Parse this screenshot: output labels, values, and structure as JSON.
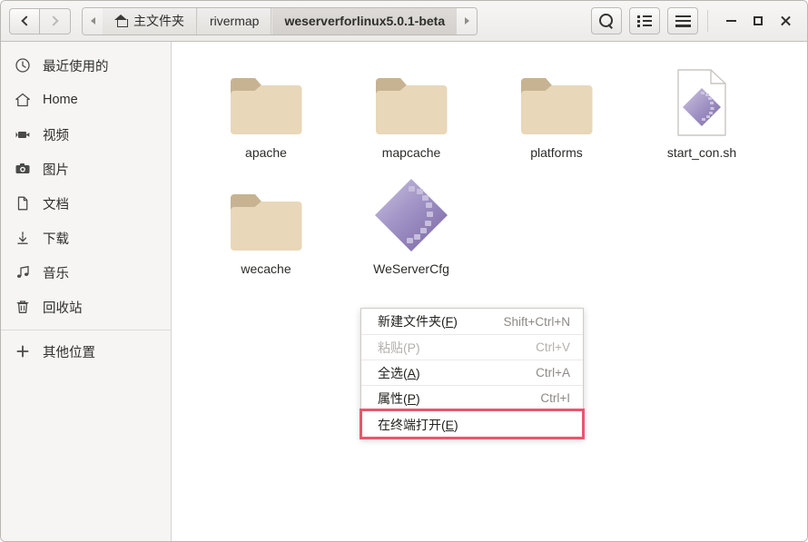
{
  "header": {
    "nav": {
      "back_label": "Back",
      "forward_label": "Forward"
    },
    "pathbar": {
      "scroll_left": "◂",
      "scroll_right": "▸",
      "crumbs": [
        {
          "label": "主文件夹",
          "icon": "home-icon",
          "active": false
        },
        {
          "label": "rivermap",
          "icon": "",
          "active": false
        },
        {
          "label": "weserverforlinux5.0.1-beta",
          "icon": "",
          "active": true
        }
      ]
    },
    "tools": [
      {
        "name": "search-button",
        "icon": "search-icon",
        "label": "Search"
      },
      {
        "name": "view-list-button",
        "icon": "list-view-icon",
        "label": "View options"
      },
      {
        "name": "main-menu-button",
        "icon": "hamburger-menu-icon",
        "label": "Menu"
      }
    ],
    "window_controls": [
      {
        "name": "minimize-button",
        "icon": "minimize-icon",
        "label": "Minimize"
      },
      {
        "name": "maximize-button",
        "icon": "maximize-icon",
        "label": "Maximize"
      },
      {
        "name": "close-button",
        "icon": "close-icon",
        "label": "Close"
      }
    ]
  },
  "sidebar": {
    "items": [
      {
        "label": "最近使用的",
        "icon": "clock-icon"
      },
      {
        "label": "Home",
        "icon": "home-icon"
      },
      {
        "label": "视频",
        "icon": "video-camera-icon"
      },
      {
        "label": "图片",
        "icon": "camera-icon"
      },
      {
        "label": "文档",
        "icon": "document-icon"
      },
      {
        "label": "下载",
        "icon": "download-arrow-icon"
      },
      {
        "label": "音乐",
        "icon": "music-note-icon"
      },
      {
        "label": "回收站",
        "icon": "trash-icon"
      }
    ],
    "other_locations": {
      "label": "其他位置",
      "icon": "plus-icon"
    }
  },
  "content": {
    "files": [
      {
        "name": "apache",
        "type": "folder"
      },
      {
        "name": "mapcache",
        "type": "folder"
      },
      {
        "name": "platforms",
        "type": "folder"
      },
      {
        "name": "start_con.sh",
        "type": "script"
      },
      {
        "name": "wecache",
        "type": "folder"
      },
      {
        "name": "WeServerCfg",
        "type": "executable"
      }
    ]
  },
  "context_menu": {
    "items": [
      {
        "label": "新建文件夹(",
        "mnemonic": "F",
        "label_end": ")",
        "accel": "Shift+Ctrl+N",
        "disabled": false,
        "highlighted": false
      },
      {
        "label": "粘贴(P",
        "mnemonic": "",
        "label_end": ")",
        "accel": "Ctrl+V",
        "disabled": true,
        "highlighted": false
      },
      {
        "label": "全选(",
        "mnemonic": "A",
        "label_end": ")",
        "accel": "Ctrl+A",
        "disabled": false,
        "highlighted": false
      },
      {
        "label": "属性(",
        "mnemonic": "P",
        "label_end": ")",
        "accel": "Ctrl+I",
        "disabled": false,
        "highlighted": false
      },
      {
        "label": "在终端打开(",
        "mnemonic": "E",
        "label_end": ")",
        "accel": "",
        "disabled": false,
        "highlighted": true
      }
    ],
    "highlight_color": "#e8566d"
  },
  "colors": {
    "folder_body": "#e8d7b8",
    "folder_tab": "#c7b392",
    "icon_purple_light": "#b3a9d0",
    "icon_purple_dark": "#7e6aa8",
    "header_bg": "#edebe9",
    "sidebar_bg": "#f6f5f4",
    "content_bg": "#ffffff"
  }
}
